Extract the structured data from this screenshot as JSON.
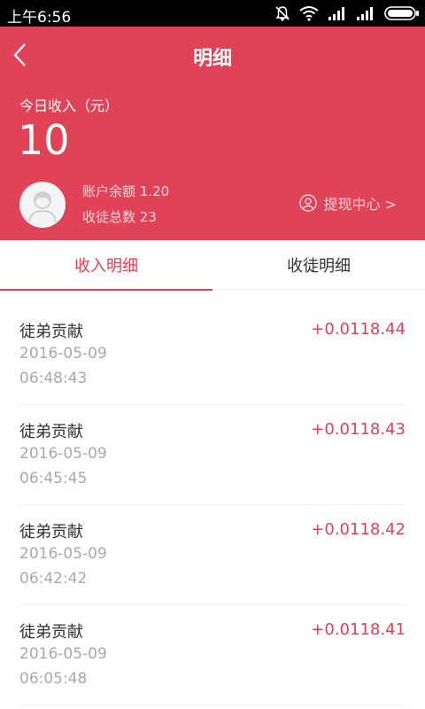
{
  "status_bar": {
    "time": "上午6:56",
    "icons": [
      "notifications-off-icon",
      "wifi-icon",
      "signal-icon",
      "signal-icon",
      "battery-icon"
    ]
  },
  "header": {
    "title": "明细",
    "today_label": "今日收入（元）",
    "today_value": "10",
    "balance_text": "账户余额 1.20",
    "disciples_text": "收徒总数 23",
    "withdraw_label": "提现中心 >",
    "accent_color": "#e04257"
  },
  "tabs": [
    {
      "label": "收入明细",
      "active": true
    },
    {
      "label": "收徒明细",
      "active": false
    }
  ],
  "records": [
    {
      "title": "徒弟贡献",
      "date": "2016-05-09",
      "time": "06:48:43",
      "amount": "+0.0118.44"
    },
    {
      "title": "徒弟贡献",
      "date": "2016-05-09",
      "time": "06:45:45",
      "amount": "+0.0118.43"
    },
    {
      "title": "徒弟贡献",
      "date": "2016-05-09",
      "time": "06:42:42",
      "amount": "+0.0118.42"
    },
    {
      "title": "徒弟贡献",
      "date": "2016-05-09",
      "time": "06:05:48",
      "amount": "+0.0118.41"
    }
  ]
}
